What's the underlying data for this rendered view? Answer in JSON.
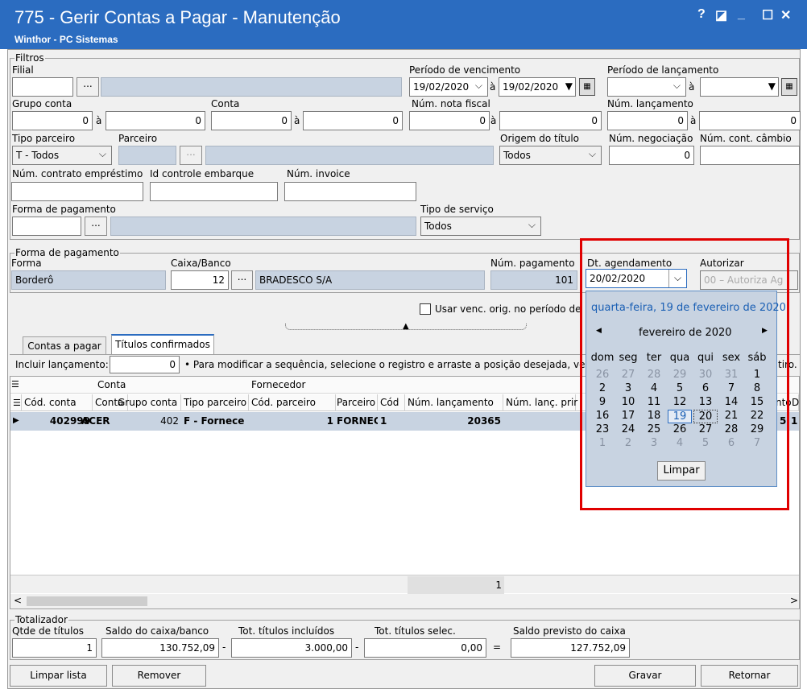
{
  "window": {
    "title": "775 - Gerir Contas a Pagar - Manutenção",
    "subtitle": "Winthor - PC Sistemas",
    "controls": [
      "?",
      "◪",
      "_",
      "☐",
      "✕"
    ]
  },
  "filtros": {
    "group": "Filtros",
    "filial_label": "Filial",
    "ellipsis": "...",
    "venc_label": "Período  de vencimento",
    "venc_de": "19/02/2020",
    "venc_ate": "19/02/2020",
    "a": "à",
    "lanc_label": "Período  de lançamento",
    "grupo_label": "Grupo conta",
    "grupo_de": "0",
    "grupo_ate": "0",
    "conta_label": "Conta",
    "conta_de": "0",
    "conta_ate": "0",
    "nf_label": "Núm. nota fiscal",
    "nf_de": "0",
    "nf_ate": "0",
    "numlanc_label": "Núm. lançamento",
    "numlanc_de": "0",
    "numlanc_ate": "0",
    "tipo_parceiro_label": "Tipo parceiro",
    "tipo_parceiro": "T - Todos",
    "parceiro_label": "Parceiro",
    "origem_label": "Origem do título",
    "origem": "Todos",
    "negociacao_label": "Núm. negociação",
    "negociacao": "0",
    "cambio_label": "Núm. cont. câmbio",
    "emprestimo_label": "Núm. contrato empréstimo",
    "embarque_label": "Id controle embarque",
    "invoice_label": "Núm. invoice",
    "forma_label": "Forma de pagamento",
    "servico_label": "Tipo de serviço",
    "servico": "Todos"
  },
  "forma": {
    "group": "Forma de pagamento",
    "forma_label": "Forma",
    "forma": "Borderô",
    "caixa_label": "Caixa/Banco",
    "caixa": "12",
    "ellipsis": "...",
    "banco": "BRADESCO S/A",
    "numpag_label": "Núm. pagamento",
    "numpag": "101",
    "agend_label": "Dt. agendamento",
    "agend": "20/02/2020",
    "autorizar_label": "Autorizar",
    "autorizar": "00 – Autoriza Ag"
  },
  "usar_venc": "Usar venc. orig. no período de",
  "tabs": [
    "Contas a pagar",
    "Títulos confirmados"
  ],
  "incluir_label": "Incluir lançamento:",
  "incluir": "0",
  "hint": "• Para modificar a sequência, selecione o registro e arraste a posição desejada, ve",
  "hint_tail": "tiro.",
  "grid": {
    "group_conta": "Conta",
    "group_fornecedor": "Fornecedor",
    "headers": [
      "Cód. conta",
      "Conta",
      "Grupo conta",
      "Tipo parceiro",
      "Cód. parceiro",
      "Parceiro",
      "Cód",
      "Núm. lançamento",
      "Núm. lanç. prir",
      "N"
    ],
    "tail_headers": [
      "nto",
      "D"
    ],
    "row": [
      "402999",
      "ACER",
      "402",
      "F - Fornece",
      "1",
      "FORNEC",
      "1",
      "20365"
    ],
    "row_tail": [
      "5",
      "1"
    ],
    "footer_count": "1"
  },
  "calendar": {
    "header": "quarta-feira, 19 de fevereiro de 2020",
    "month": "fevereiro de 2020",
    "prev": "◀",
    "next": "▶",
    "dow": [
      "dom",
      "seg",
      "ter",
      "qua",
      "qui",
      "sex",
      "sáb"
    ],
    "weeks": [
      [
        "26",
        "27",
        "28",
        "29",
        "30",
        "31",
        "1"
      ],
      [
        "2",
        "3",
        "4",
        "5",
        "6",
        "7",
        "8"
      ],
      [
        "9",
        "10",
        "11",
        "12",
        "13",
        "14",
        "15"
      ],
      [
        "16",
        "17",
        "18",
        "19",
        "20",
        "21",
        "22"
      ],
      [
        "23",
        "24",
        "25",
        "26",
        "27",
        "28",
        "29"
      ],
      [
        "1",
        "2",
        "3",
        "4",
        "5",
        "6",
        "7"
      ]
    ],
    "limpar": "Limpar"
  },
  "totalizador": {
    "group": "Totalizador",
    "qtde_label": "Qtde de títulos",
    "qtde": "1",
    "saldo_label": "Saldo do caixa/banco",
    "saldo": "130.752,09",
    "minus": "-",
    "incl_label": "Tot. títulos incluídos",
    "incl": "3.000,00",
    "selec_label": "Tot. títulos selec.",
    "selec": "0,00",
    "eq": "=",
    "prev_label": "Saldo previsto do caixa",
    "prev": "127.752,09"
  },
  "buttons": {
    "limpar": "Limpar lista",
    "remover": "Remover",
    "gravar": "Gravar",
    "retornar": "Retornar"
  },
  "colors": {
    "title_bar": "#2b6cc0",
    "highlight": "#e00000",
    "calendar_bg": "#c8d3e1",
    "calendar_header": "#1a5fb4"
  }
}
